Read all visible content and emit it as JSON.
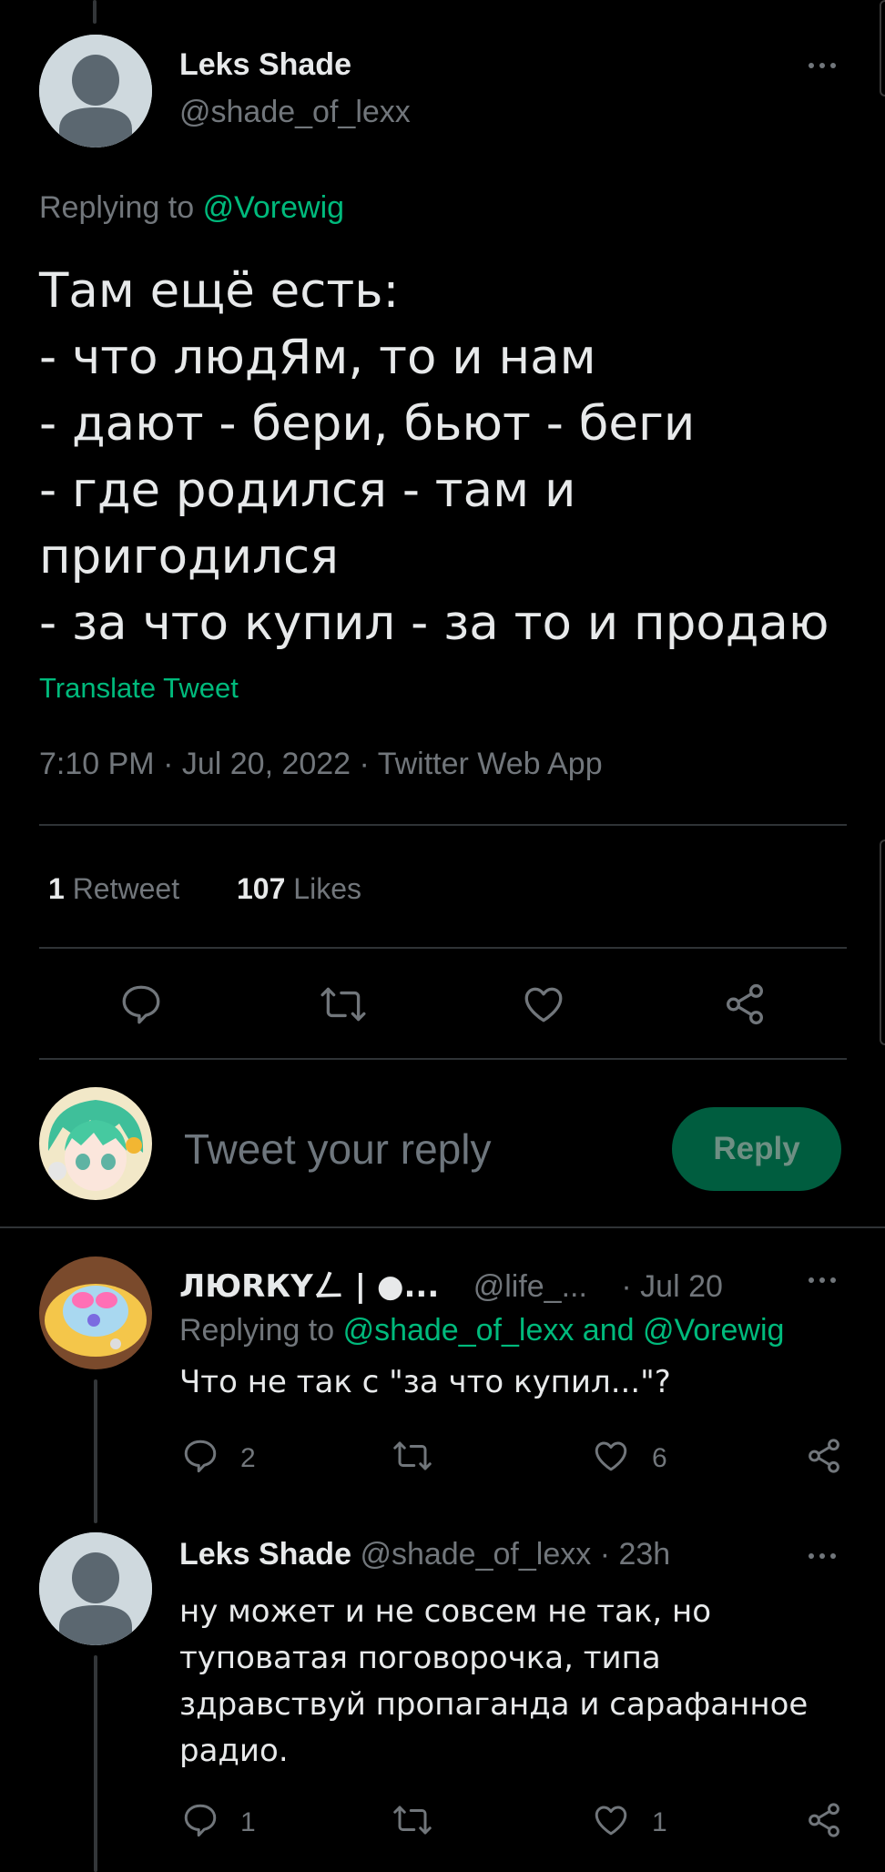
{
  "main_tweet": {
    "author_name": "Leks Shade",
    "author_handle": "@shade_of_lexx",
    "replying_prefix": "Replying to",
    "replying_handle": "@Vorewig",
    "lines": [
      "Там ещё есть:",
      "- что людЯм, то и нам",
      "- дают - бери, бьют - беги",
      "- где родился - там и",
      "пригодился",
      "- за что купил - за то и продаю"
    ],
    "translate": "Translate Tweet",
    "meta": "7:10 PM · Jul 20, 2022 · Twitter Web App",
    "retweet_count": "1",
    "retweet_label": "Retweet",
    "likes_count": "107",
    "likes_label": "Likes"
  },
  "composer": {
    "placeholder": "Tweet your reply",
    "button": "Reply"
  },
  "replies": [
    {
      "author_name": "ЛЮRКYㄥ | ●...",
      "author_handle": "@life_...",
      "time": "· Jul 20",
      "replying_prefix": "Replying to",
      "replying_handles": "@shade_of_lexx and @Vorewig",
      "text_lines": [
        "Что не так с \"за что купил...\"?"
      ],
      "reply_count": "2",
      "like_count": "6"
    },
    {
      "author_name": "Leks Shade",
      "author_handle": "@shade_of_lexx",
      "time": "· 23h",
      "text_lines": [
        "ну может и не совсем не так, но",
        "туповатая поговорочка, типа",
        "здравствуй пропаганда и сарафанное",
        "радио."
      ],
      "reply_count": "1",
      "like_count": "1"
    }
  ],
  "colors": {
    "background": "#000000",
    "accent": "#00ba7c",
    "muted": "#71767b",
    "divider": "#2f3336",
    "reply_button_bg": "#005d3f"
  }
}
